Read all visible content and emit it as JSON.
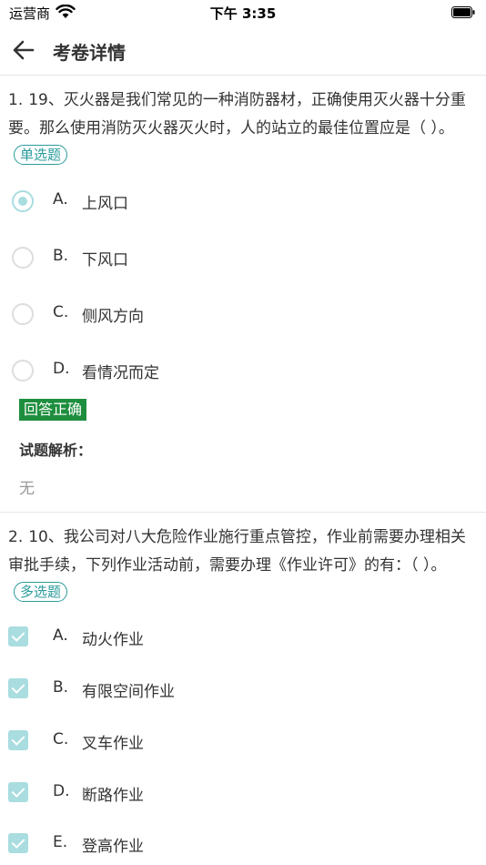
{
  "status_bar": {
    "carrier": "运营商",
    "time": "下午 3:35"
  },
  "header": {
    "title": "考卷详情"
  },
  "questions": [
    {
      "number": "1.",
      "text": "19、灭火器是我们常见的一种消防器材，正确使用灭火器十分重要。那么使用消防灭火器灭火时，人的站立的最佳位置应是（ ）。",
      "type_tag": "单选题",
      "options": [
        {
          "letter": "A.",
          "text": "上风口",
          "selected": true
        },
        {
          "letter": "B.",
          "text": "下风口",
          "selected": false
        },
        {
          "letter": "C.",
          "text": "侧风方向",
          "selected": false
        },
        {
          "letter": "D.",
          "text": "看情况而定",
          "selected": false
        }
      ],
      "result": "回答正确",
      "analysis_label": "试题解析：",
      "analysis": "无"
    },
    {
      "number": "2.",
      "text": "10、我公司对八大危险作业施行重点管控，作业前需要办理相关审批手续，下列作业活动前，需要办理《作业许可》的有：（ ）。",
      "type_tag": "多选题",
      "options": [
        {
          "letter": "A.",
          "text": "动火作业",
          "selected": true
        },
        {
          "letter": "B.",
          "text": "有限空间作业",
          "selected": true
        },
        {
          "letter": "C.",
          "text": "叉车作业",
          "selected": true
        },
        {
          "letter": "D.",
          "text": "断路作业",
          "selected": true
        },
        {
          "letter": "E.",
          "text": "登高作业",
          "selected": true
        }
      ]
    }
  ],
  "colors": {
    "accent": "#2b9b9b",
    "selected_fill": "#a9dde0",
    "correct_badge": "#1e8e3e",
    "muted_text": "#999999"
  },
  "icons": {
    "back": "arrow-left-icon",
    "wifi": "wifi-icon",
    "battery": "battery-icon"
  }
}
